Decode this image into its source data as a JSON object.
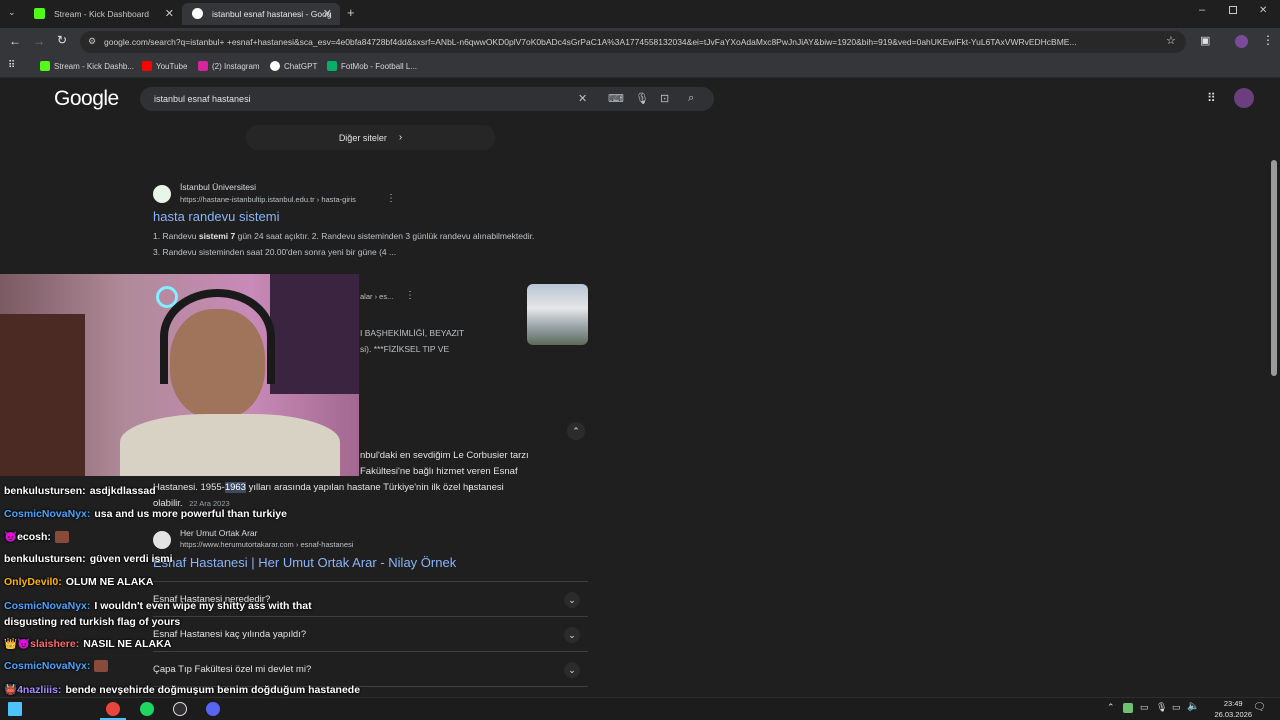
{
  "tabs": [
    {
      "title": "Stream - Kick Dashboard",
      "icon": "kick-icon",
      "color": "#53fc18",
      "active": false
    },
    {
      "title": "istanbul esnaf hastanesi - Goog",
      "icon": "google-icon",
      "color": "#4285f4",
      "active": true
    }
  ],
  "address_bar": {
    "url": "google.com/search?q=istanbul+ +esnaf+hastanesi&sca_esv=4e0bfa84728bf4dd&sxsrf=ANbL-n6qwwOKD0plV7oK0bADc4sGrPaC1A%3A1774558132034&ei=tJvFaYXoAdaMxc8PwJnJiAY&biw=1920&bih=919&ved=0ahUKEwiFkt-YuL6TAxVWRvEDHcBME..."
  },
  "bookmarks": [
    {
      "label": "Stream - Kick Dashb...",
      "color": "#53fc18"
    },
    {
      "label": "YouTube",
      "color": "#ff0000"
    },
    {
      "label": "(2) Instagram",
      "color": "#d6249f"
    },
    {
      "label": "ChatGPT",
      "color": "#ffffff"
    },
    {
      "label": "FotMob - Football L...",
      "color": "#00b16a"
    }
  ],
  "search": {
    "logo": "Google",
    "query": "istanbul esnaf hastanesi"
  },
  "more_sites": "Diğer siteler",
  "results": [
    {
      "source": "İstanbul Üniversitesi",
      "url": "https://hastane-istanbultip.istanbul.edu.tr › hasta-giris",
      "title": "hasta randevu sistemi",
      "snippet_line1_pre": "1. Randevu ",
      "snippet_line1_bold": "sistemi 7",
      "snippet_line1_post": " gün 24 saat açıktır. 2. Randevu sisteminden 3 günlük randevu alınabilmektedir.",
      "snippet_line2": "3. Randevu sisteminden saat 20.00'den sonra yeni bir güne (4 ..."
    }
  ],
  "partial_result": {
    "url_tail": "alar › es...",
    "line1": "I BAŞHEKİMLİĞİ, BEYAZIT",
    "line2": "si). ***FİZİKSEL TIP VE"
  },
  "featured_snippet": {
    "line1": "nbul'daki en sevdiğim Le Corbusier tarzı",
    "line2": "Fakültesi'ne bağlı hizmet veren Esnaf",
    "line3_pre": "Hastanesi. 1955-",
    "line3_highlight": "1963",
    "line3_post": " yılları arasında yapılan hastane Türkiye'nin ilk özel hastanesi",
    "line4": "olabilir.",
    "date": "22 Ara 2023"
  },
  "result2": {
    "source": "Her Umut Ortak Arar",
    "url": "https://www.herumutortakarar.com › esnaf-hastanesi",
    "title": "Esnaf Hastanesi | Her Umut Ortak Arar - Nilay Örnek"
  },
  "people_also_ask": [
    "Esnaf Hastanesi nerededir?",
    "Esnaf Hastanesi kaç yılında yapıldı?",
    "Çapa Tıp Fakültesi özel mi devlet mi?"
  ],
  "chat": [
    {
      "user": "benkulustursen:",
      "color": "#ffffff",
      "text": "asdjkdlassad"
    },
    {
      "user": "CosmicNovaNyx:",
      "color": "#4aa3ff",
      "text": "usa and us more powerful than turkiye"
    },
    {
      "user": "ecosh:",
      "color": "#ffffff",
      "text": ""
    },
    {
      "user": "benkulustursen:",
      "color": "#ffffff",
      "text": "güven verdi ismi"
    },
    {
      "user": "OnlyDevil0:",
      "color": "#ffb400",
      "text": "OLUM NE ALAKA"
    },
    {
      "user": "CosmicNovaNyx:",
      "color": "#4aa3ff",
      "text": "I wouldn't even wipe my shitty ass with that disgusting red turkish flag of yours"
    },
    {
      "user": "slaishere:",
      "color": "#ff6b6b",
      "text": "NASIL NE ALAKA"
    },
    {
      "user": "CosmicNovaNyx:",
      "color": "#4aa3ff",
      "text": ""
    },
    {
      "user": "4nazliiis:",
      "color": "#a78bff",
      "text": "bende nevşehirde doğmuşum benim doğduğum hastanede yıkılmışşş"
    }
  ],
  "clock": {
    "time": "23:49",
    "date": "26.03.2026"
  }
}
